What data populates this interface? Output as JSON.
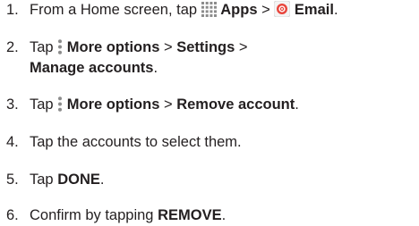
{
  "steps": [
    {
      "number": "1.",
      "text_a": "From a Home screen, tap",
      "icon_a": "apps-grid-icon",
      "bold_a": "Apps",
      "sep_a": " > ",
      "icon_b": "email-app-icon",
      "bold_b": "Email",
      "end": "."
    },
    {
      "number": "2.",
      "text_a": "Tap",
      "icon_a": "more-options-icon",
      "bold_a": "More options",
      "sep_a": " > ",
      "bold_b": "Settings",
      "sep_b": " >",
      "bold_c": "Manage accounts",
      "end": "."
    },
    {
      "number": "3.",
      "text_a": "Tap",
      "icon_a": "more-options-icon",
      "bold_a": "More options",
      "sep_a": " > ",
      "bold_b": "Remove account",
      "end": "."
    },
    {
      "number": "4.",
      "text_a": "Tap the accounts to select them."
    },
    {
      "number": "5.",
      "text_a": "Tap ",
      "bold_a": "DONE",
      "end": "."
    },
    {
      "number": "6.",
      "text_a": "Confirm by tapping ",
      "bold_a": "REMOVE",
      "end": "."
    }
  ],
  "colors": {
    "text": "#231f20",
    "icon_gray": "#8c8c8c",
    "email_red": "#e8453c"
  }
}
